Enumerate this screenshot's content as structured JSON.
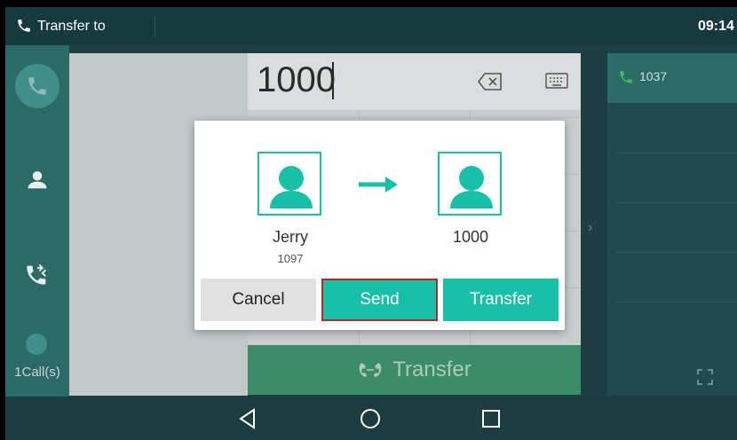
{
  "status_bar": {
    "title": "Transfer to",
    "time": "09:14"
  },
  "sidebar": {
    "items": [
      {
        "icon": "phone-icon",
        "active": true
      },
      {
        "icon": "contact-icon",
        "active": false
      },
      {
        "icon": "call-history-icon",
        "active": false
      }
    ],
    "calls_label": "1Call(s)"
  },
  "dialer": {
    "number": "1000",
    "transfer_label": "Transfer"
  },
  "call_list": {
    "items": [
      {
        "number": "1037"
      }
    ]
  },
  "dialog": {
    "from": {
      "name": "Jerry",
      "number": "1097"
    },
    "to": {
      "name": "1000"
    },
    "buttons": {
      "cancel": "Cancel",
      "send": "Send",
      "transfer": "Transfer"
    }
  },
  "colors": {
    "accent": "#19c0a8",
    "highlight_border": "#b8262e",
    "sidebar": "#2c6a68",
    "transfer_bar": "#3c8b69"
  }
}
